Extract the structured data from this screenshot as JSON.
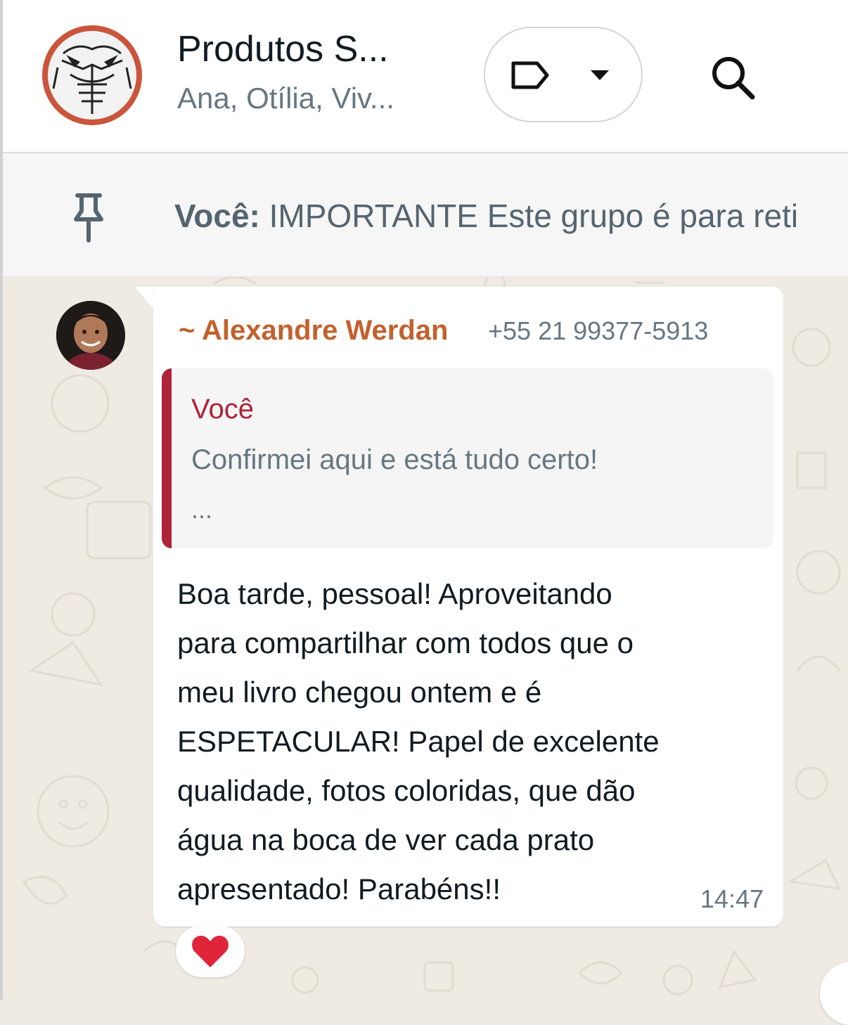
{
  "header": {
    "title": "Produtos S...",
    "subtitle": "Ana, Otília, Viv..."
  },
  "pinned": {
    "author": "Você:",
    "text": "IMPORTANTE  Este grupo é para reti"
  },
  "message": {
    "sender_name": "~ Alexandre Werdan",
    "sender_phone": "+55 21 99377-5913",
    "quote": {
      "author": "Você",
      "text": "Confirmei aqui e está tudo certo!",
      "more": "..."
    },
    "body": "Boa tarde, pessoal! Aproveitando\npara compartilhar com todos que o\nmeu livro chegou ontem e é\nESPETACULAR! Papel de excelente\nqualidade, fotos coloridas, que dão\nágua na boca de ver cada prato\napresentado! Parabéns!!",
    "time": "14:47",
    "reaction": "❤"
  },
  "colors": {
    "sender": "#c2612e",
    "quote_accent": "#b0233a",
    "wallpaper": "#efeae2"
  },
  "icons": [
    "label-icon",
    "caret-down-icon",
    "search-icon",
    "pin-icon",
    "heart-icon"
  ]
}
